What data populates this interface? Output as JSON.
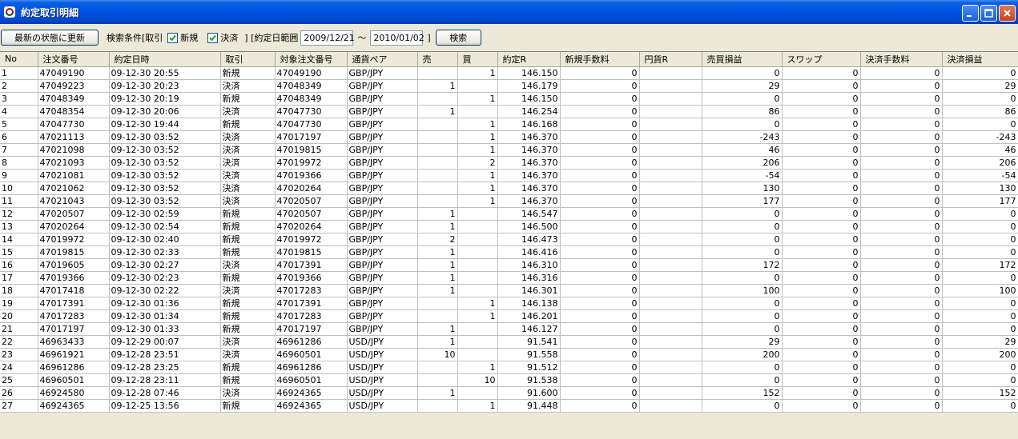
{
  "window": {
    "title": "約定取引明細"
  },
  "toolbar": {
    "refresh_label": "最新の状態に更新",
    "search_condition_label": "検索条件[取引",
    "new_checkbox_label": "新規",
    "new_checked": true,
    "settle_checkbox_label": "決済",
    "settle_checked": true,
    "date_range_label": "] [約定日範囲",
    "date_from": "2009/12/21",
    "range_separator": "〜",
    "date_to": "2010/01/02",
    "close_bracket": "]",
    "search_label": "検索"
  },
  "table": {
    "columns": [
      "No",
      "注文番号",
      "約定日時",
      "取引",
      "対象注文番号",
      "通貨ペア",
      "売",
      "買",
      "約定R",
      "新規手数料",
      "円貨R",
      "売買損益",
      "スワップ",
      "決済手数料",
      "決済損益"
    ],
    "rows": [
      [
        "1",
        "47049190",
        "09-12-30 20:55",
        "新規",
        "47049190",
        "GBP/JPY",
        "",
        "1",
        "146.150",
        "0",
        "",
        "0",
        "0",
        "0",
        "0"
      ],
      [
        "2",
        "47049223",
        "09-12-30 20:23",
        "決済",
        "47048349",
        "GBP/JPY",
        "1",
        "",
        "146.179",
        "0",
        "",
        "29",
        "0",
        "0",
        "29"
      ],
      [
        "3",
        "47048349",
        "09-12-30 20:19",
        "新規",
        "47048349",
        "GBP/JPY",
        "",
        "1",
        "146.150",
        "0",
        "",
        "0",
        "0",
        "0",
        "0"
      ],
      [
        "4",
        "47048354",
        "09-12-30 20:06",
        "決済",
        "47047730",
        "GBP/JPY",
        "1",
        "",
        "146.254",
        "0",
        "",
        "86",
        "0",
        "0",
        "86"
      ],
      [
        "5",
        "47047730",
        "09-12-30 19:44",
        "新規",
        "47047730",
        "GBP/JPY",
        "",
        "1",
        "146.168",
        "0",
        "",
        "0",
        "0",
        "0",
        "0"
      ],
      [
        "6",
        "47021113",
        "09-12-30 03:52",
        "決済",
        "47017197",
        "GBP/JPY",
        "",
        "1",
        "146.370",
        "0",
        "",
        "-243",
        "0",
        "0",
        "-243"
      ],
      [
        "7",
        "47021098",
        "09-12-30 03:52",
        "決済",
        "47019815",
        "GBP/JPY",
        "",
        "1",
        "146.370",
        "0",
        "",
        "46",
        "0",
        "0",
        "46"
      ],
      [
        "8",
        "47021093",
        "09-12-30 03:52",
        "決済",
        "47019972",
        "GBP/JPY",
        "",
        "2",
        "146.370",
        "0",
        "",
        "206",
        "0",
        "0",
        "206"
      ],
      [
        "9",
        "47021081",
        "09-12-30 03:52",
        "決済",
        "47019366",
        "GBP/JPY",
        "",
        "1",
        "146.370",
        "0",
        "",
        "-54",
        "0",
        "0",
        "-54"
      ],
      [
        "10",
        "47021062",
        "09-12-30 03:52",
        "決済",
        "47020264",
        "GBP/JPY",
        "",
        "1",
        "146.370",
        "0",
        "",
        "130",
        "0",
        "0",
        "130"
      ],
      [
        "11",
        "47021043",
        "09-12-30 03:52",
        "決済",
        "47020507",
        "GBP/JPY",
        "",
        "1",
        "146.370",
        "0",
        "",
        "177",
        "0",
        "0",
        "177"
      ],
      [
        "12",
        "47020507",
        "09-12-30 02:59",
        "新規",
        "47020507",
        "GBP/JPY",
        "1",
        "",
        "146.547",
        "0",
        "",
        "0",
        "0",
        "0",
        "0"
      ],
      [
        "13",
        "47020264",
        "09-12-30 02:54",
        "新規",
        "47020264",
        "GBP/JPY",
        "1",
        "",
        "146.500",
        "0",
        "",
        "0",
        "0",
        "0",
        "0"
      ],
      [
        "14",
        "47019972",
        "09-12-30 02:40",
        "新規",
        "47019972",
        "GBP/JPY",
        "2",
        "",
        "146.473",
        "0",
        "",
        "0",
        "0",
        "0",
        "0"
      ],
      [
        "15",
        "47019815",
        "09-12-30 02:33",
        "新規",
        "47019815",
        "GBP/JPY",
        "1",
        "",
        "146.416",
        "0",
        "",
        "0",
        "0",
        "0",
        "0"
      ],
      [
        "16",
        "47019605",
        "09-12-30 02:27",
        "決済",
        "47017391",
        "GBP/JPY",
        "1",
        "",
        "146.310",
        "0",
        "",
        "172",
        "0",
        "0",
        "172"
      ],
      [
        "17",
        "47019366",
        "09-12-30 02:23",
        "新規",
        "47019366",
        "GBP/JPY",
        "1",
        "",
        "146.316",
        "0",
        "",
        "0",
        "0",
        "0",
        "0"
      ],
      [
        "18",
        "47017418",
        "09-12-30 02:22",
        "決済",
        "47017283",
        "GBP/JPY",
        "1",
        "",
        "146.301",
        "0",
        "",
        "100",
        "0",
        "0",
        "100"
      ],
      [
        "19",
        "47017391",
        "09-12-30 01:36",
        "新規",
        "47017391",
        "GBP/JPY",
        "",
        "1",
        "146.138",
        "0",
        "",
        "0",
        "0",
        "0",
        "0"
      ],
      [
        "20",
        "47017283",
        "09-12-30 01:34",
        "新規",
        "47017283",
        "GBP/JPY",
        "",
        "1",
        "146.201",
        "0",
        "",
        "0",
        "0",
        "0",
        "0"
      ],
      [
        "21",
        "47017197",
        "09-12-30 01:33",
        "新規",
        "47017197",
        "GBP/JPY",
        "1",
        "",
        "146.127",
        "0",
        "",
        "0",
        "0",
        "0",
        "0"
      ],
      [
        "22",
        "46963433",
        "09-12-29 00:07",
        "決済",
        "46961286",
        "USD/JPY",
        "1",
        "",
        "91.541",
        "0",
        "",
        "29",
        "0",
        "0",
        "29"
      ],
      [
        "23",
        "46961921",
        "09-12-28 23:51",
        "決済",
        "46960501",
        "USD/JPY",
        "10",
        "",
        "91.558",
        "0",
        "",
        "200",
        "0",
        "0",
        "200"
      ],
      [
        "24",
        "46961286",
        "09-12-28 23:25",
        "新規",
        "46961286",
        "USD/JPY",
        "",
        "1",
        "91.512",
        "0",
        "",
        "0",
        "0",
        "0",
        "0"
      ],
      [
        "25",
        "46960501",
        "09-12-28 23:11",
        "新規",
        "46960501",
        "USD/JPY",
        "",
        "10",
        "91.538",
        "0",
        "",
        "0",
        "0",
        "0",
        "0"
      ],
      [
        "26",
        "46924580",
        "09-12-28 07:46",
        "決済",
        "46924365",
        "USD/JPY",
        "1",
        "",
        "91.600",
        "0",
        "",
        "152",
        "0",
        "0",
        "152"
      ],
      [
        "27",
        "46924365",
        "09-12-25 13:56",
        "新規",
        "46924365",
        "USD/JPY",
        "",
        "1",
        "91.448",
        "0",
        "",
        "0",
        "0",
        "0",
        "0"
      ]
    ]
  }
}
